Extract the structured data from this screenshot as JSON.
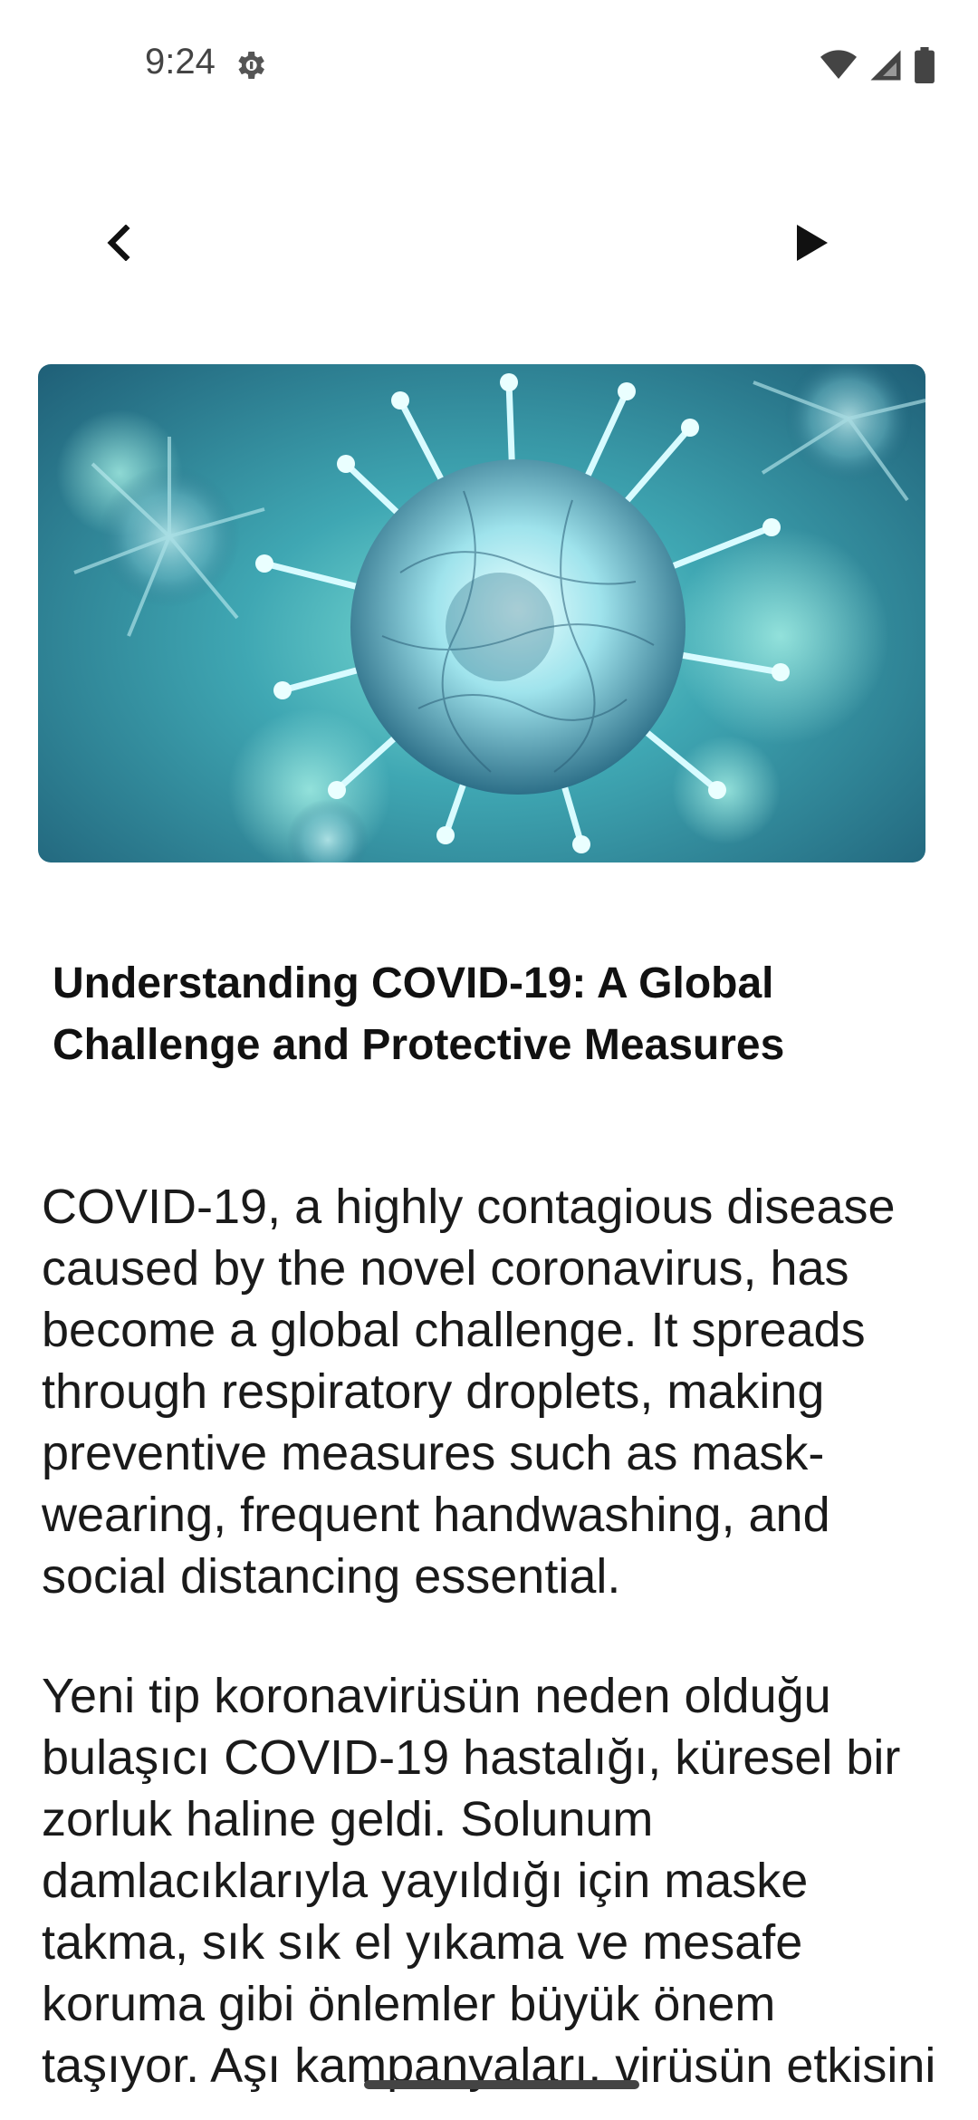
{
  "status_bar": {
    "time": "9:24",
    "icons": [
      "settings-gear-icon",
      "wifi-icon",
      "cellular-signal-icon",
      "battery-icon"
    ]
  },
  "toolbar": {
    "back_icon": "chevron-left-icon",
    "play_icon": "play-icon"
  },
  "hero_image": {
    "subject": "coronavirus-particles"
  },
  "article": {
    "title": "Understanding COVID-19: A Global Challenge and Protective Measures",
    "text_en": "COVID-19, a highly contagious disease caused by the novel coronavirus, has become a global challenge. It spreads through respiratory droplets, making preventive measures such as mask-wearing, frequent handwashing, and social distancing essential.",
    "text_tr": "Yeni tip koronavirüsün neden olduğu bulaşıcı COVID-19 hastalığı, küresel bir zorluk haline geldi. Solunum damlacıklarıyla yayıldığı için maske takma, sık sık el yıkama ve mesafe koruma gibi önlemler büyük önem taşıyor. Aşı kampanyaları, virüsün etkisini hafifletmede önemli rol oynuyor."
  },
  "colors": {
    "background": "#ffffff",
    "text": "#1a1a1a",
    "icon": "#111111"
  }
}
